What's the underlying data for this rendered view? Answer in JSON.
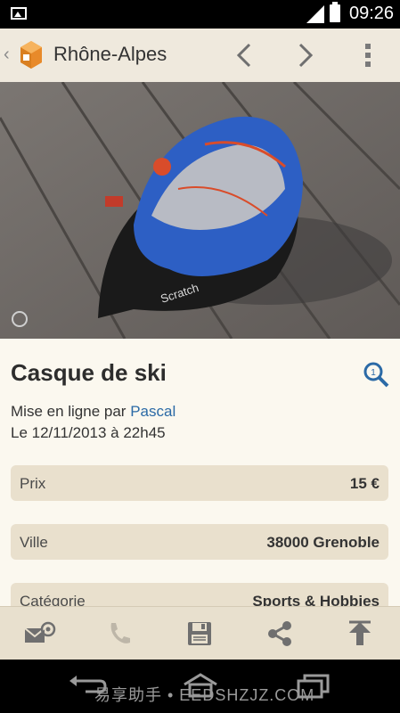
{
  "status_bar": {
    "time": "09:26"
  },
  "app_bar": {
    "title": "Rhône-Alpes"
  },
  "ad": {
    "title": "Casque de ski",
    "posted_by_prefix": "Mise en ligne par",
    "author": "Pascal",
    "date": "Le 12/11/2013 à 22h45",
    "details": [
      {
        "label": "Prix",
        "value": "15 €"
      },
      {
        "label": "Ville",
        "value": "38000 Grenoble"
      },
      {
        "label": "Catégorie",
        "value": "Sports & Hobbies"
      }
    ]
  },
  "watermark": "易享助手 • EEDSHZJZ.COM",
  "colors": {
    "accent": "#2b6aa6",
    "app_bar": "#efe9dd",
    "row_bg": "#e9e0cd",
    "action_bar": "#e8e0ce"
  },
  "icons": {
    "status": [
      "gallery-icon",
      "signal-icon",
      "battery-icon"
    ],
    "app_bar": [
      "back-chevron-icon",
      "app-logo",
      "chevron-left-icon",
      "chevron-right-icon",
      "overflow-menu-icon"
    ],
    "actions": [
      "email-icon",
      "phone-icon",
      "save-icon",
      "share-icon",
      "scroll-top-icon"
    ]
  }
}
